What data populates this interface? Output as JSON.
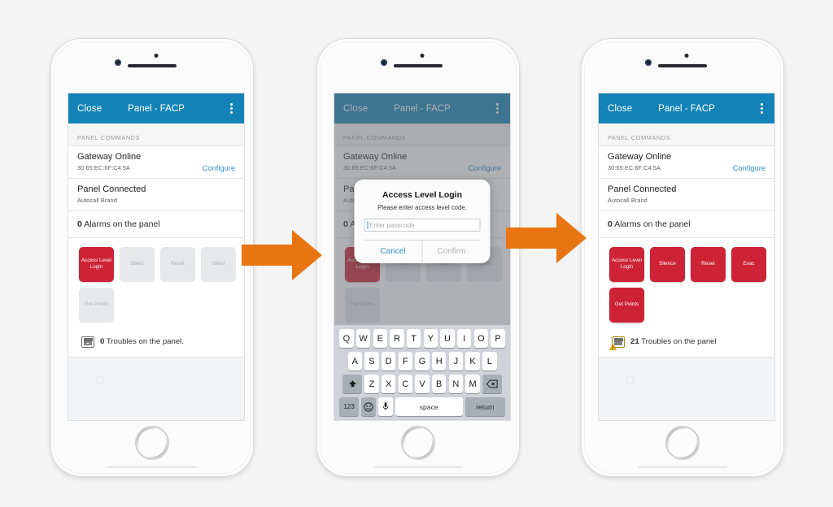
{
  "accent": {
    "navbar": "#1383b7",
    "active_button": "#ce2236",
    "link": "#2e8fd0",
    "arrow": "#e87511"
  },
  "nav": {
    "close_label": "Close",
    "title": "Panel - FACP",
    "menu_icon": "kebab-menu-icon"
  },
  "section": {
    "header": "PANEL COMMANDS"
  },
  "rows": {
    "gateway": {
      "title": "Gateway Online",
      "subtitle": "30:65:EC:6F:C4:5A",
      "action": "Configure"
    },
    "panel": {
      "title": "Panel Connected",
      "subtitle": "Autocall Brand"
    },
    "alarms": {
      "count": "0",
      "text": "Alarms on the panel"
    }
  },
  "screen_1": {
    "commands": [
      {
        "label": "Access Level Login",
        "state": "active"
      },
      {
        "label": "Silent",
        "state": "disabled"
      },
      {
        "label": "Reset",
        "state": "disabled"
      },
      {
        "label": "Silent",
        "state": "disabled"
      },
      {
        "label": "Get Points",
        "state": "disabled"
      }
    ],
    "troubles": {
      "count": "0",
      "text": "Troubles on the panel.",
      "icon": "keypad-icon"
    }
  },
  "screen_3": {
    "commands": [
      {
        "label": "Access Level Login",
        "state": "active"
      },
      {
        "label": "Silence",
        "state": "active"
      },
      {
        "label": "Reset",
        "state": "active"
      },
      {
        "label": "Evac",
        "state": "active"
      },
      {
        "label": "Get Points",
        "state": "active"
      }
    ],
    "troubles": {
      "count": "21",
      "text": "Troubles on the panel",
      "icon": "keypad-warning-icon"
    }
  },
  "dialog": {
    "title": "Access Level Login",
    "message": "Please enter access level code.",
    "input_value": "",
    "input_placeholder": "Enter passcode",
    "cancel_label": "Cancel",
    "confirm_label": "Confirm"
  },
  "keyboard": {
    "row1": [
      "Q",
      "W",
      "E",
      "R",
      "T",
      "Y",
      "U",
      "I",
      "O",
      "P"
    ],
    "row2": [
      "A",
      "S",
      "D",
      "F",
      "G",
      "H",
      "J",
      "K",
      "L"
    ],
    "row3": [
      "Z",
      "X",
      "C",
      "V",
      "B",
      "N",
      "M"
    ],
    "shift_icon": "shift-up-arrow-icon",
    "backspace_icon": "backspace-delete-icon",
    "numbers_label": "123",
    "emoji_icon": "smiley-face-icon",
    "mic_icon": "microphone-icon",
    "space_label": "space",
    "return_label": "return"
  }
}
